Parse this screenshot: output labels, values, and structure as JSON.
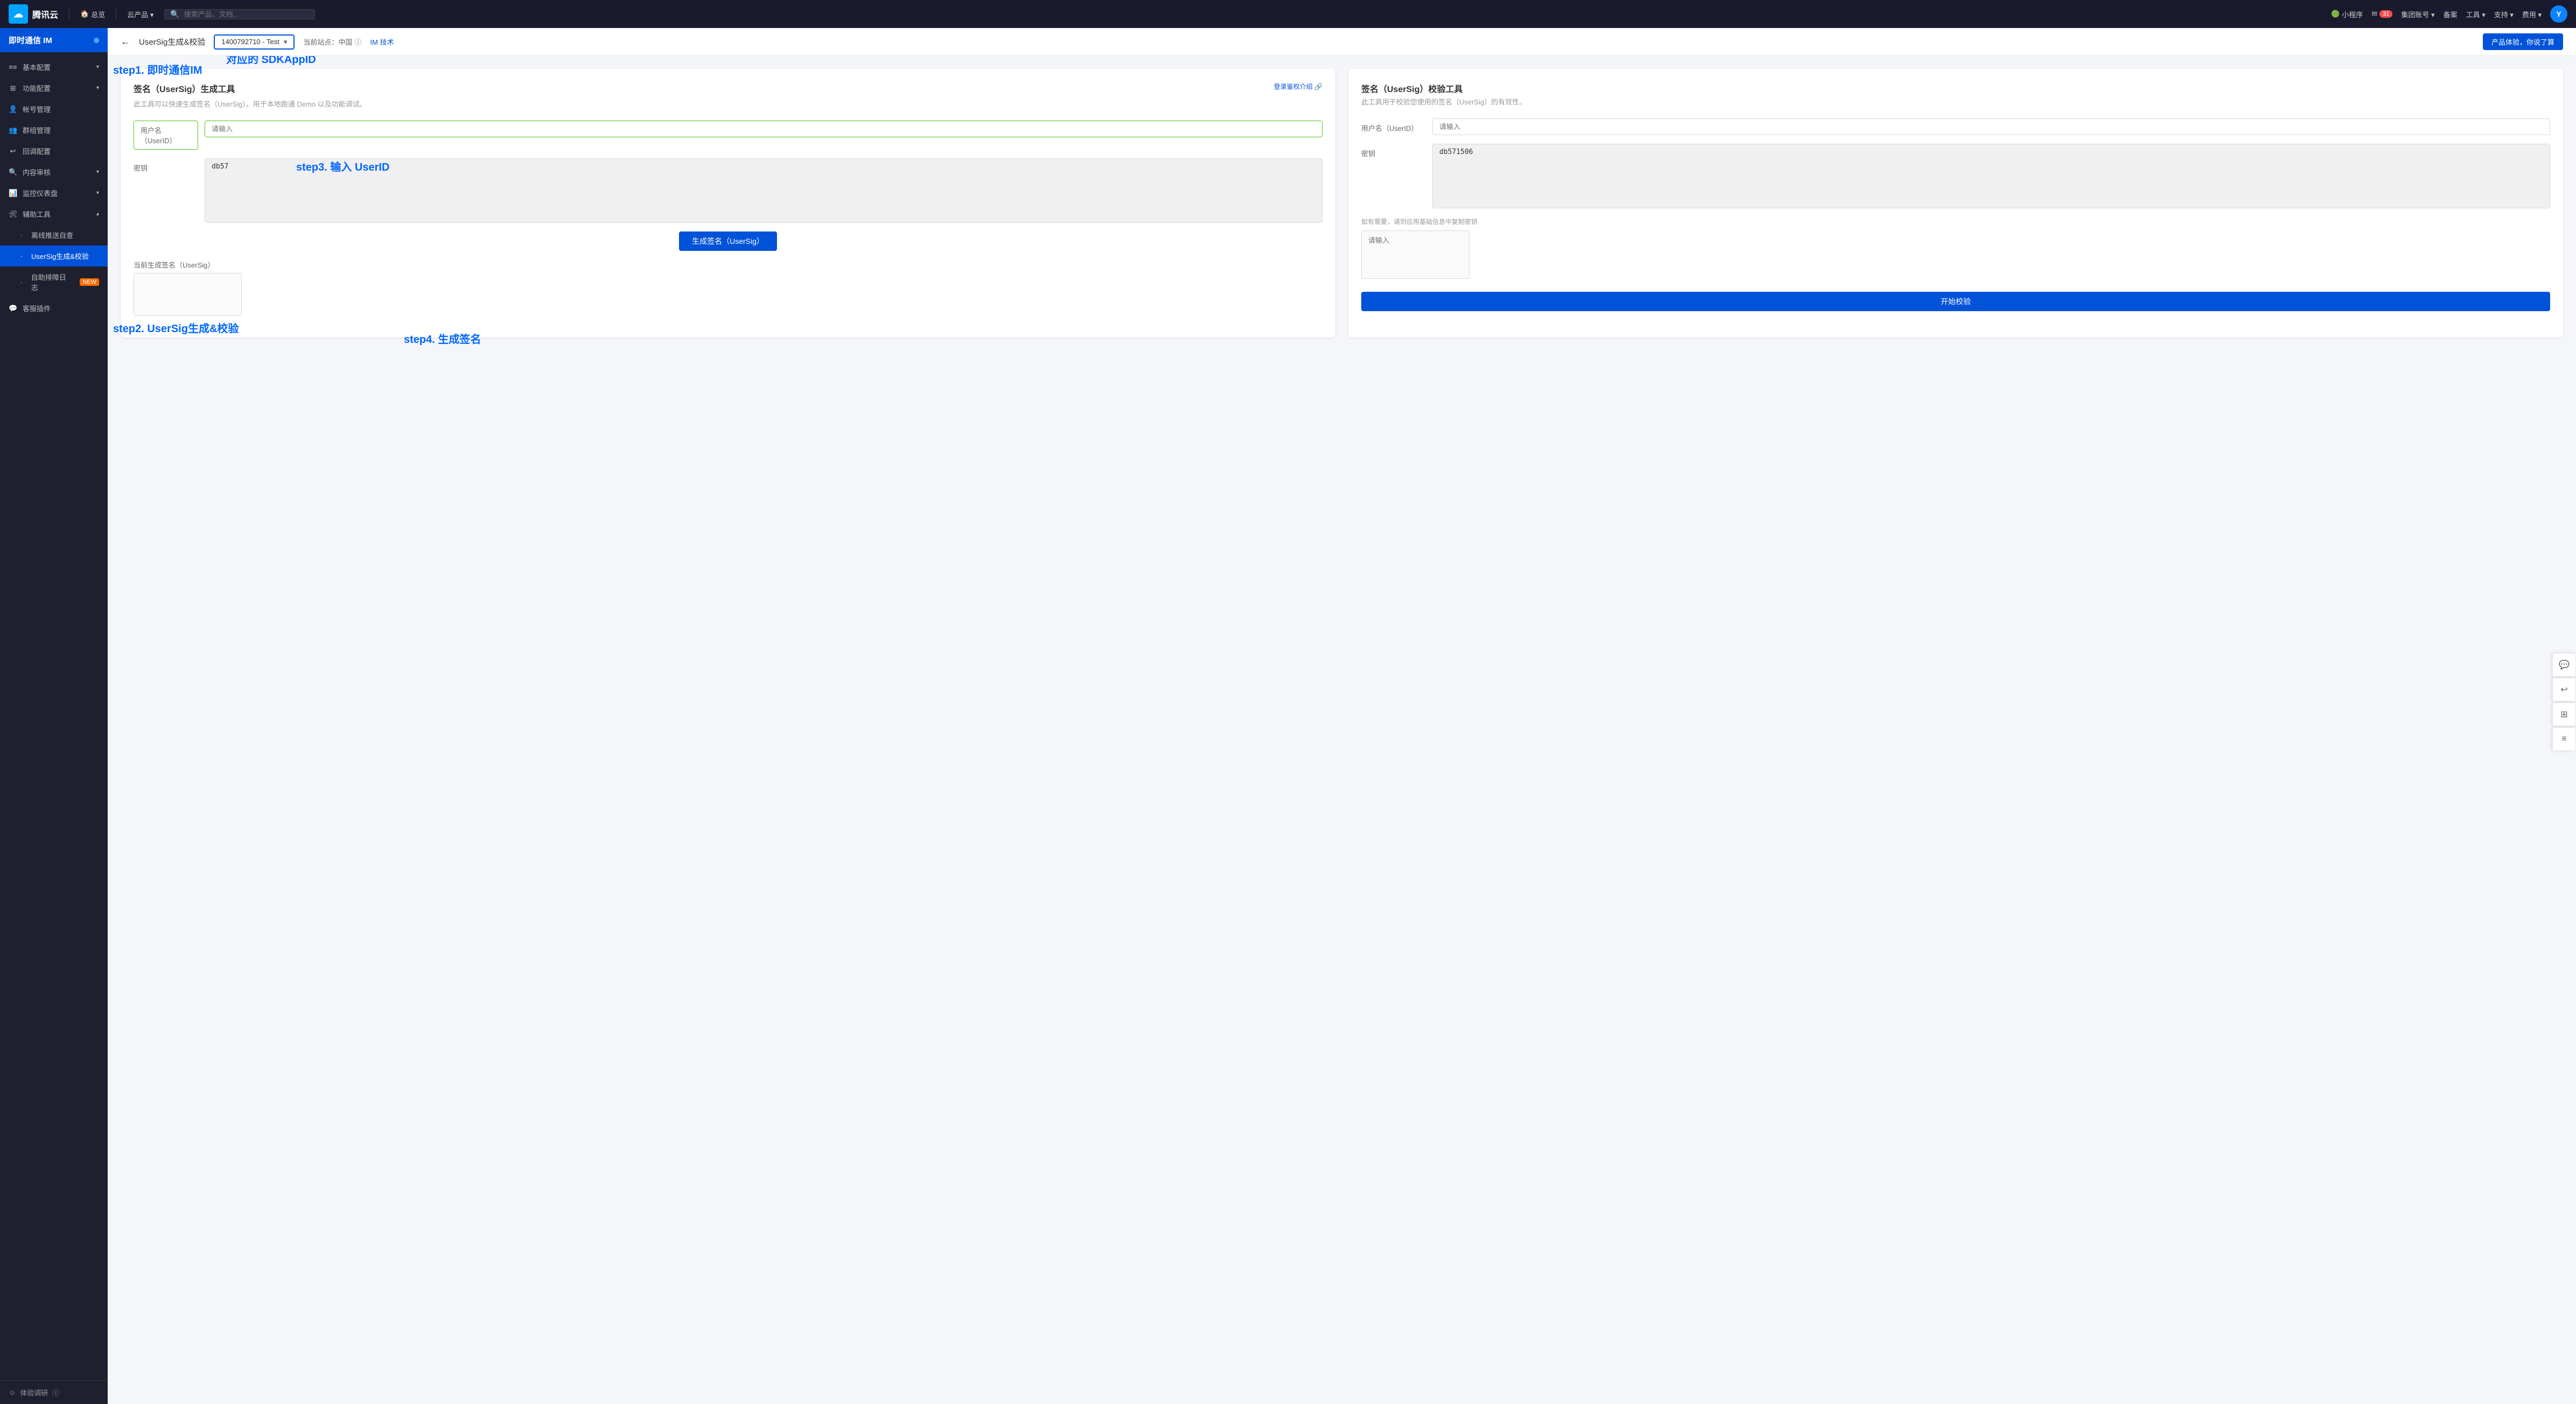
{
  "topNav": {
    "logo": "腾讯云",
    "nav_items": [
      {
        "label": "总览",
        "icon": "🏠"
      },
      {
        "label": "云产品 ▾"
      }
    ],
    "search_placeholder": "搜索产品、文档...",
    "right_items": [
      {
        "label": "小程序",
        "icon": "🟢"
      },
      {
        "label": "消息",
        "icon": "✉",
        "badge": "31"
      },
      {
        "label": "集团账号 ▾"
      },
      {
        "label": "备案"
      },
      {
        "label": "工具 ▾"
      },
      {
        "label": "支持 ▾"
      },
      {
        "label": "费用 ▾"
      },
      {
        "label": "Y",
        "type": "avatar"
      }
    ]
  },
  "sidebar": {
    "header": "即时通信 IM",
    "items": [
      {
        "label": "基本配置",
        "icon": "⚙",
        "expandable": true
      },
      {
        "label": "功能配置",
        "icon": "🔧",
        "expandable": true
      },
      {
        "label": "帐号管理",
        "icon": "👤"
      },
      {
        "label": "群组管理",
        "icon": "👥"
      },
      {
        "label": "回调配置",
        "icon": "🔄"
      },
      {
        "label": "内容审核",
        "icon": "🔍",
        "expandable": true
      },
      {
        "label": "监控仪表盘",
        "icon": "📊",
        "expandable": true
      },
      {
        "label": "辅助工具",
        "icon": "🛠",
        "expandable": true,
        "expanded": true
      },
      {
        "label": "离线推送自查",
        "sub": true
      },
      {
        "label": "UserSig生成&校验",
        "sub": true,
        "active": true
      },
      {
        "label": "自助排障日志",
        "sub": true,
        "new": true
      },
      {
        "label": "客服插件",
        "icon": "💬"
      }
    ],
    "footer": "体验调研"
  },
  "pageHeader": {
    "back_label": "←",
    "title": "UserSig生成&校验",
    "app_selector": "1400792710 - Test",
    "site_label": "当前站点：中国",
    "tech_link": "IM 技术",
    "login_auth_link": "登录鉴权介绍 🔗",
    "experience_btn": "产品体验，你说了算"
  },
  "generateTool": {
    "title": "签名（UserSig）生成工具",
    "description": "此工具可以快速生成签名（UserSig），用于本地跑通 Demo 以及功能调试。",
    "userid_label": "用户名（UserID）",
    "userid_placeholder": "请输入",
    "key_label": "密钥",
    "key_value": "db57",
    "generate_btn": "生成签名（UserSig）",
    "result_label": "当前生成签名（UserSig）"
  },
  "verifyTool": {
    "title": "签名（UserSig）校验工具",
    "description": "此工具用于校验您使用的签名（UserSig）的有效性。",
    "userid_label": "用户名（UserID）",
    "userid_placeholder": "请输入",
    "key_label": "密钥",
    "key_value": "db571506",
    "key_hint": "如有需要，请到应用基础信息中复制密钥",
    "usersig_placeholder": "请输入",
    "verify_btn": "开始校验"
  },
  "annotations": {
    "step1": "step1. 即时通信IM",
    "step2": "step2. UserSig生成&校验",
    "step3": "step3. 输入 UserID",
    "step4": "step4. 生成签名",
    "sdk_label": "对应的 SDKAppID"
  },
  "rightSidebar": {
    "icons": [
      "💬",
      "↩",
      "🔲",
      "≡"
    ]
  }
}
